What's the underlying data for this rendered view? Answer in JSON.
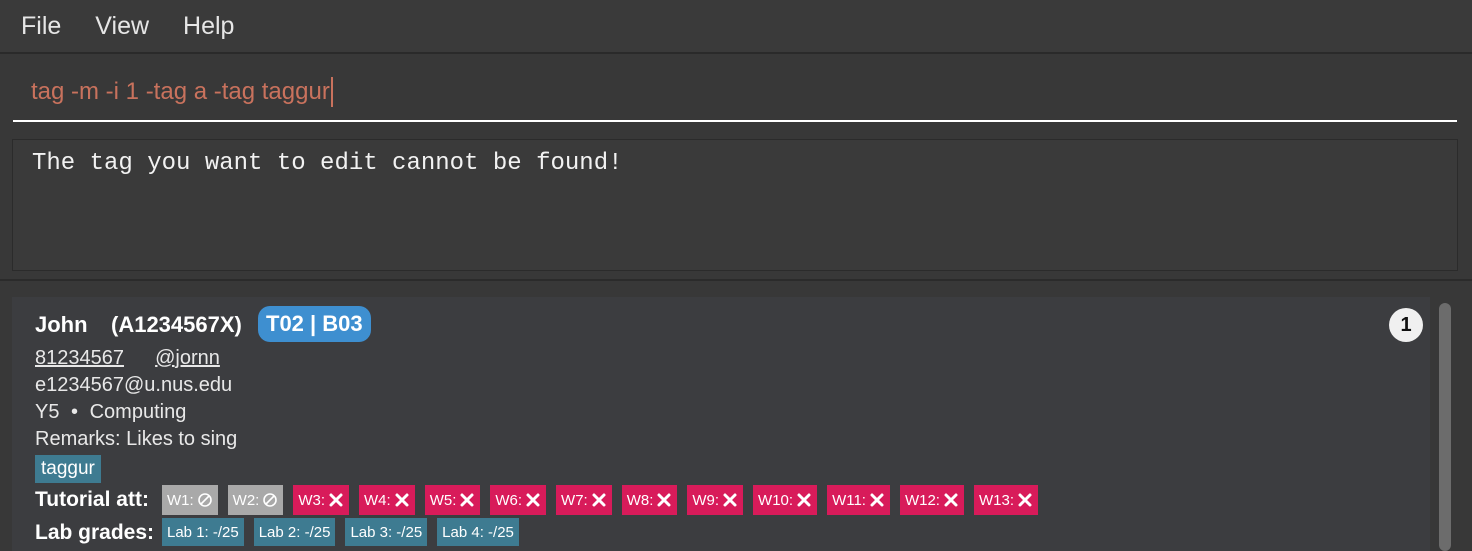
{
  "menu": {
    "items": [
      "File",
      "View",
      "Help"
    ]
  },
  "command": {
    "value": "tag -m -i 1 -tag a -tag taggur"
  },
  "result": {
    "message": "The tag you want to edit cannot be found!"
  },
  "person": {
    "index": "1",
    "name": "John",
    "student_id": "(A1234567X)",
    "class_tag": "T02 | B03",
    "phone": "81234567",
    "telegram": "@jornn",
    "email": "e1234567@u.nus.edu",
    "year": "Y5",
    "separator": "•",
    "major": "Computing",
    "remarks": "Remarks: Likes to sing",
    "tag": "taggur",
    "tutorial_label": "Tutorial att:",
    "tutorial_att": [
      {
        "label": "W1:",
        "status": "na"
      },
      {
        "label": "W2:",
        "status": "na"
      },
      {
        "label": "W3:",
        "status": "absent"
      },
      {
        "label": "W4:",
        "status": "absent"
      },
      {
        "label": "W5:",
        "status": "absent"
      },
      {
        "label": "W6:",
        "status": "absent"
      },
      {
        "label": "W7:",
        "status": "absent"
      },
      {
        "label": "W8:",
        "status": "absent"
      },
      {
        "label": "W9:",
        "status": "absent"
      },
      {
        "label": "W10:",
        "status": "absent"
      },
      {
        "label": "W11:",
        "status": "absent"
      },
      {
        "label": "W12:",
        "status": "absent"
      },
      {
        "label": "W13:",
        "status": "absent"
      }
    ],
    "lab_label": "Lab grades:",
    "lab_grades": [
      "Lab 1: -/25",
      "Lab 2: -/25",
      "Lab 3: -/25",
      "Lab 4: -/25"
    ]
  },
  "colors": {
    "absent": "#d81b5a",
    "na": "#a9a9a9",
    "class_tag": "#3e8fd0",
    "tag": "#3e7b91",
    "command_text": "#c9725d"
  }
}
